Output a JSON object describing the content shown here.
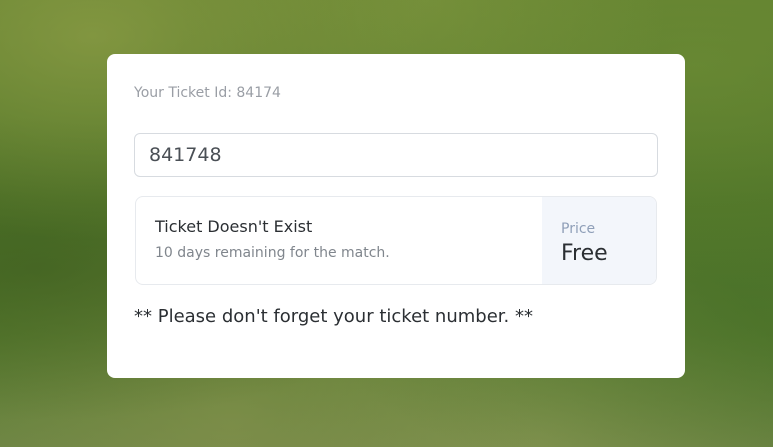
{
  "ticket_card": {
    "ticket_id_label": "Your Ticket Id: 84174",
    "ticket_input_value": "841748",
    "status": {
      "title": "Ticket Doesn't Exist",
      "subtitle": "10 days remaining for the match."
    },
    "price": {
      "label": "Price",
      "value": "Free"
    },
    "reminder": "** Please don't forget your ticket number. **"
  },
  "colors": {
    "card_background": "#ffffff",
    "price_panel_background": "#f3f6fb",
    "price_label": "#8f9fb8",
    "muted_text": "#9a9ea5",
    "primary_text": "#2b2f33"
  }
}
